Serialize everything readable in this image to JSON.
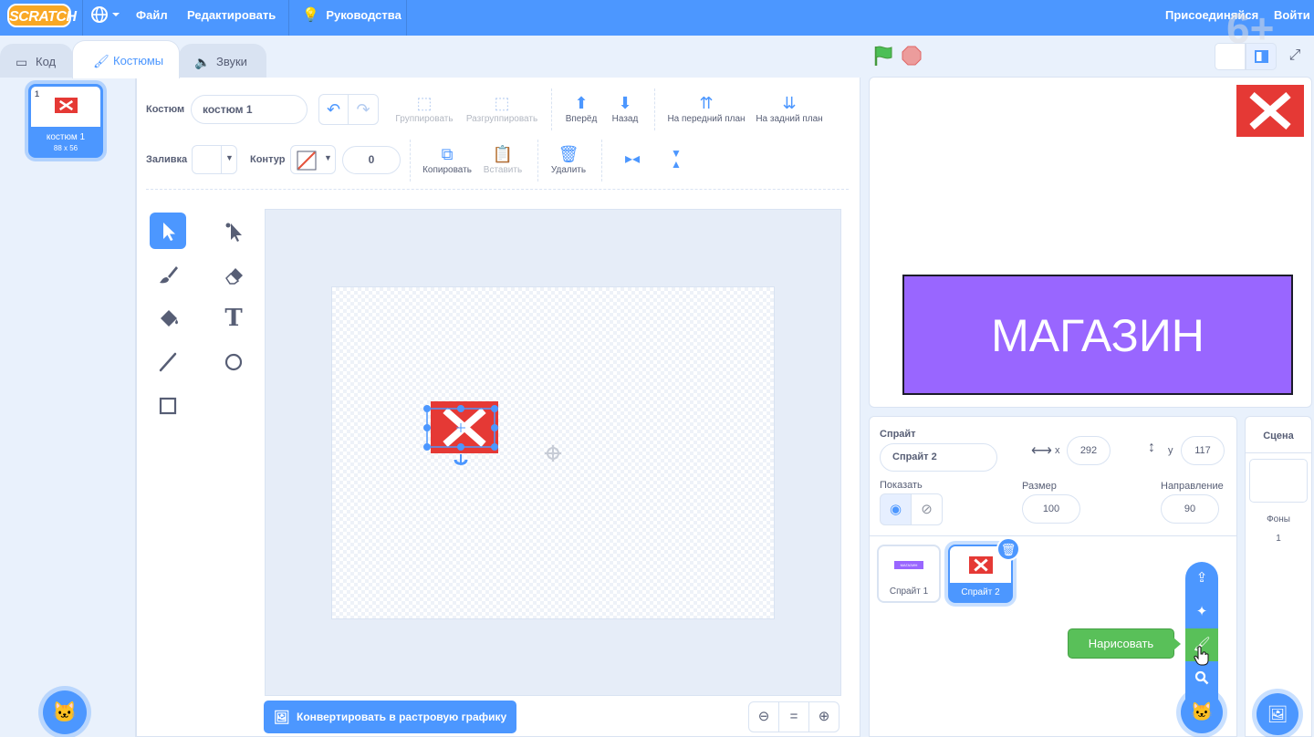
{
  "menu": {
    "logo": "SCRATCH",
    "file": "Файл",
    "edit": "Редактировать",
    "tutorials": "Руководства",
    "join": "Присоединяйся",
    "signin": "Войти",
    "age_badge": "6+"
  },
  "tabs": [
    {
      "label": "Код"
    },
    {
      "label": "Костюмы"
    },
    {
      "label": "Звуки"
    }
  ],
  "costume_list": [
    {
      "number": "1",
      "name": "костюм 1",
      "size": "88 x 56"
    }
  ],
  "toolbar": {
    "costume_label": "Костюм",
    "costume_name": "костюм 1",
    "group": "Группировать",
    "ungroup": "Разгруппировать",
    "forward": "Вперёд",
    "backward": "Назад",
    "front": "На передний план",
    "back": "На задний план",
    "fill_label": "Заливка",
    "outline_label": "Контур",
    "outline_width": "0",
    "copy": "Копировать",
    "paste": "Вставить",
    "delete": "Удалить"
  },
  "canvas": {
    "convert_button": "Конвертировать в растровую графику",
    "zoom_reset": "="
  },
  "stage": {
    "banner_text": "МАГАЗИН",
    "banner_color": "#9966ff",
    "costume_color": "#e53935"
  },
  "sprite_info": {
    "sprite_label": "Спрайт",
    "sprite_name": "Спрайт 2",
    "x_label": "x",
    "x_value": "292",
    "y_label": "y",
    "y_value": "117",
    "show_label": "Показать",
    "size_label": "Размер",
    "size_value": "100",
    "direction_label": "Направление",
    "direction_value": "90"
  },
  "sprites": [
    {
      "name": "Спрайт 1",
      "thumb_text": "МАГАЗИН"
    },
    {
      "name": "Спрайт 2"
    }
  ],
  "popup_menu": {
    "tooltip": "Нарисовать"
  },
  "stage_panel": {
    "title": "Сцена",
    "backdrops_label": "Фоны",
    "backdrops_count": "1"
  },
  "colors": {
    "accent": "#4c97ff",
    "green": "#59c059",
    "purple": "#9966ff"
  }
}
